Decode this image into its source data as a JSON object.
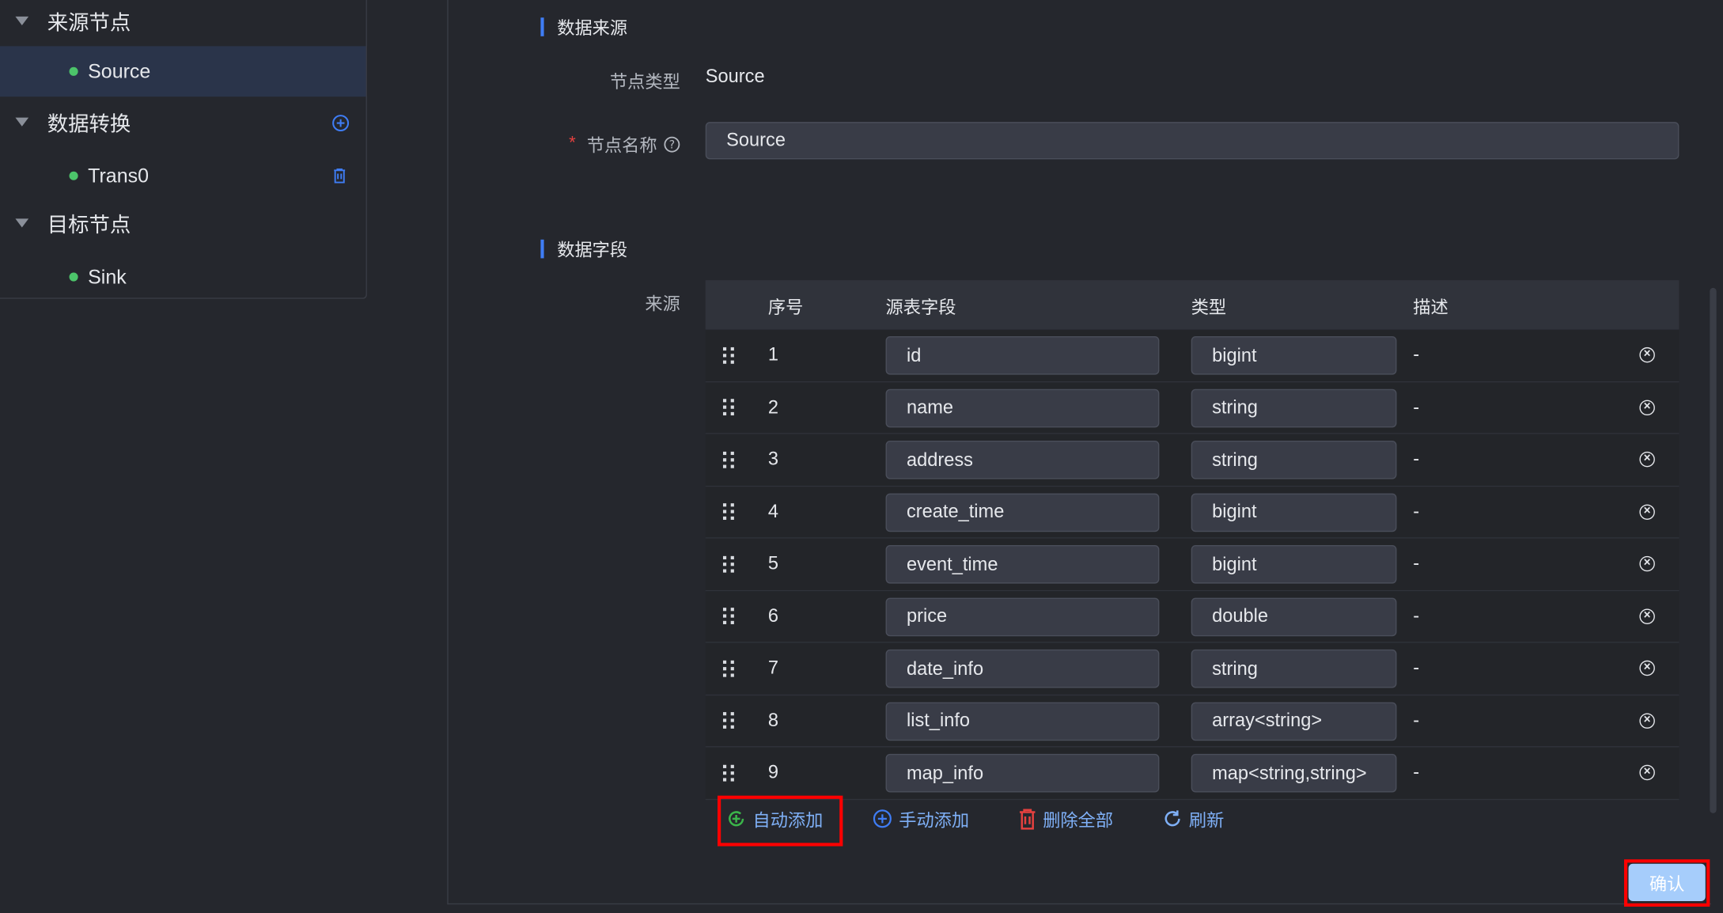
{
  "tree": {
    "groups": [
      {
        "label": "来源节点",
        "children": [
          {
            "label": "Source",
            "selected": true
          }
        ]
      },
      {
        "label": "数据转换",
        "children": [
          {
            "label": "Trans0"
          }
        ]
      },
      {
        "label": "目标节点",
        "children": [
          {
            "label": "Sink"
          }
        ]
      }
    ]
  },
  "form": {
    "section_source": "数据来源",
    "node_type_label": "节点类型",
    "node_type_value": "Source",
    "node_name_label": "节点名称",
    "node_name_value": "Source",
    "required_mark": "*",
    "section_fields": "数据字段",
    "source_label": "来源"
  },
  "table": {
    "headers": [
      "序号",
      "源表字段",
      "类型",
      "描述"
    ],
    "rows": [
      {
        "no": "1",
        "field": "id",
        "type": "bigint",
        "desc": "-"
      },
      {
        "no": "2",
        "field": "name",
        "type": "string",
        "desc": "-"
      },
      {
        "no": "3",
        "field": "address",
        "type": "string",
        "desc": "-"
      },
      {
        "no": "4",
        "field": "create_time",
        "type": "bigint",
        "desc": "-"
      },
      {
        "no": "5",
        "field": "event_time",
        "type": "bigint",
        "desc": "-"
      },
      {
        "no": "6",
        "field": "price",
        "type": "double",
        "desc": "-"
      },
      {
        "no": "7",
        "field": "date_info",
        "type": "string",
        "desc": "-"
      },
      {
        "no": "8",
        "field": "list_info",
        "type": "array<string>",
        "desc": "-"
      },
      {
        "no": "9",
        "field": "map_info",
        "type": "map<string,string>",
        "desc": "-"
      }
    ]
  },
  "actions": {
    "auto_add": "自动添加",
    "manual_add": "手动添加",
    "delete_all": "删除全部",
    "refresh": "刷新",
    "confirm": "确认"
  },
  "colors": {
    "accent": "#3f7df5",
    "success": "#4cc46a",
    "danger": "#e5413f",
    "highlight": "#ff0000",
    "confirm_bg": "#a6cdfb"
  }
}
